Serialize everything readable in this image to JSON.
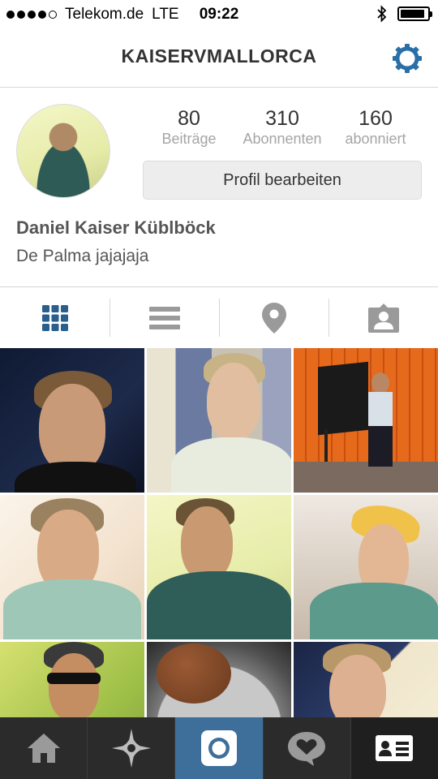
{
  "status_bar": {
    "carrier": "Telekom.de",
    "network": "LTE",
    "time": "09:22",
    "signal_dots_filled": 4,
    "signal_dots_total": 5,
    "battery_level": 0.9
  },
  "header": {
    "title": "KAISERVMALLORCA",
    "settings_icon": "gear-icon",
    "accent_color": "#2a6fa8"
  },
  "profile": {
    "stats": [
      {
        "value": "80",
        "label": "Beiträge"
      },
      {
        "value": "310",
        "label": "Abonnenten"
      },
      {
        "value": "160",
        "label": "abonniert"
      }
    ],
    "edit_button_label": "Profil bearbeiten",
    "full_name": "Daniel Kaiser Küblböck",
    "bio": "De Palma jajajaja"
  },
  "view_tabs": [
    {
      "icon": "grid-icon",
      "active": true
    },
    {
      "icon": "list-icon",
      "active": false
    },
    {
      "icon": "location-pin-icon",
      "active": false
    },
    {
      "icon": "tagged-person-icon",
      "active": false
    }
  ],
  "bottom_nav": [
    {
      "icon": "home-icon"
    },
    {
      "icon": "explore-star-icon"
    },
    {
      "icon": "camera-icon",
      "active": true
    },
    {
      "icon": "activity-heart-icon"
    },
    {
      "icon": "profile-card-icon"
    }
  ],
  "colors": {
    "active_tab": "#2a5e8c",
    "inactive_tab": "#9a9a9a",
    "bottom_bar": "#2b2b2b",
    "bottom_bar_active": "#3e6e9a"
  }
}
